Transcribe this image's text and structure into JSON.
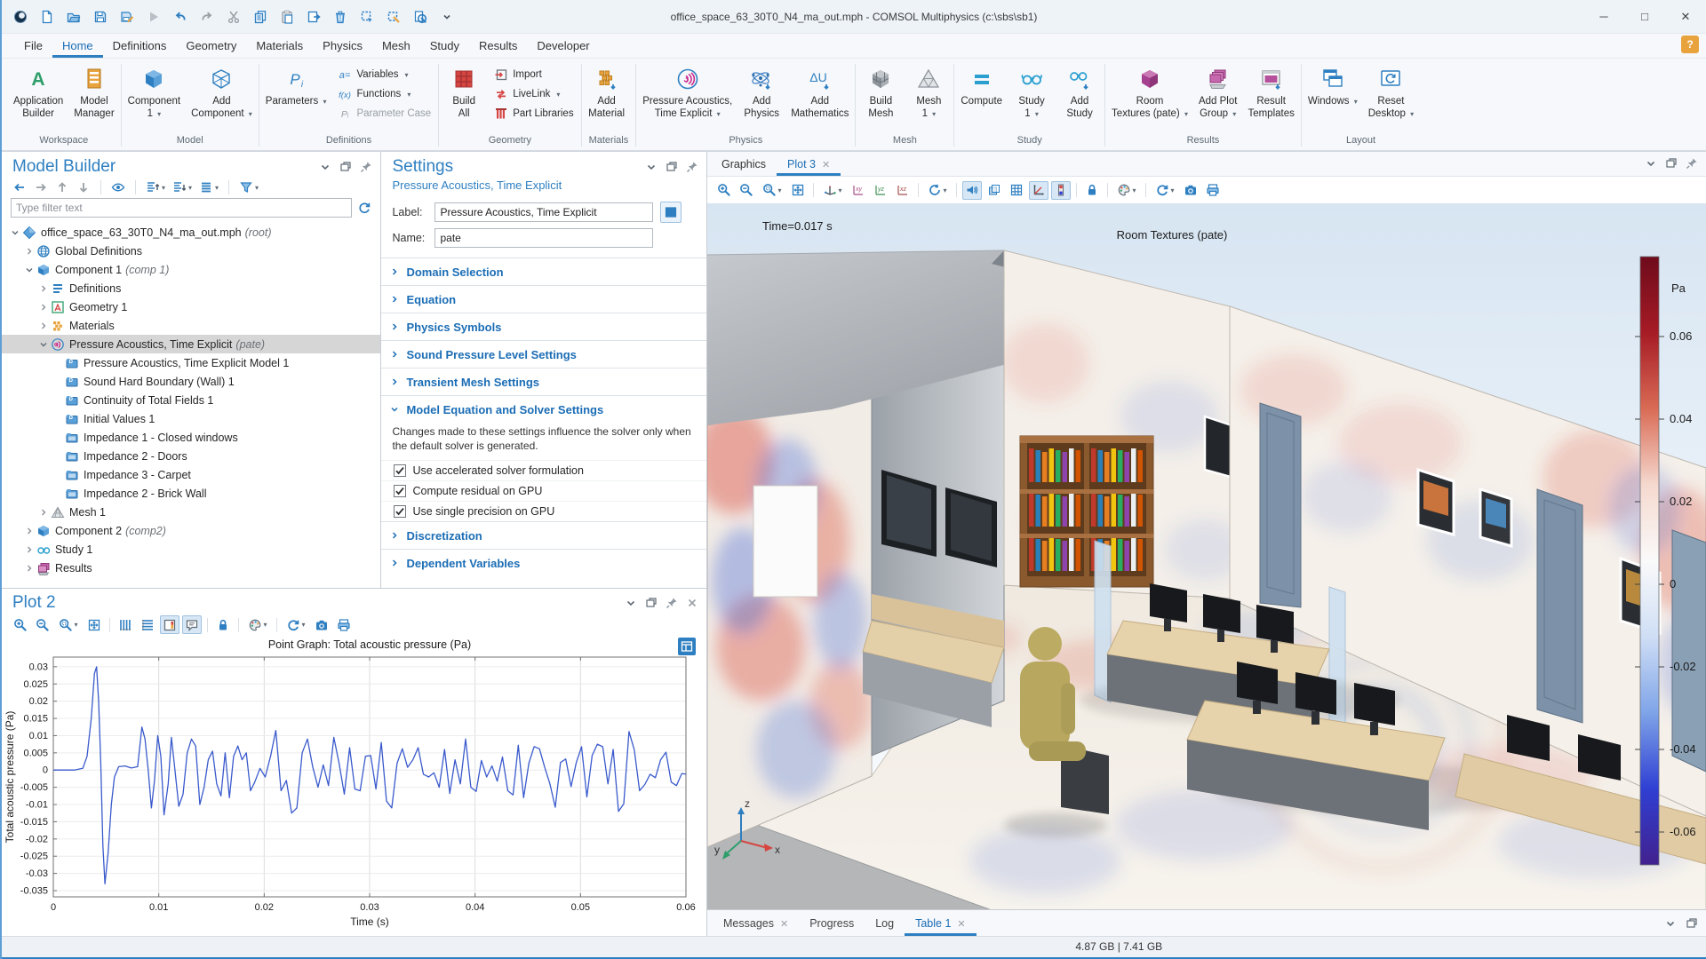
{
  "colors": {
    "accent": "#2e7fc1",
    "link": "#1b6db5",
    "selection": "#d6d6d6",
    "line": "#3a5acc",
    "ribbon_red": "#d64541",
    "ribbon_orange": "#e8a33d",
    "ribbon_green": "#2e9e6b",
    "ribbon_teal": "#2a9fd0",
    "ribbon_magenta": "#b5509c"
  },
  "window": {
    "title": "office_space_63_30T0_N4_ma_out.mph - COMSOL Multiphysics (c:\\sbs\\sb1)",
    "controls": [
      "minimize",
      "maximize",
      "close"
    ]
  },
  "quickbar": [
    "comsol-logo",
    "new-file",
    "open-file",
    "save",
    "save-as",
    "run",
    "undo",
    "redo",
    "cut",
    "copy",
    "paste",
    "duplicate",
    "delete",
    "select-box",
    "clear-selection",
    "zoom-selected",
    "collapse-ribbon"
  ],
  "menu": {
    "items": [
      "File",
      "Home",
      "Definitions",
      "Geometry",
      "Materials",
      "Physics",
      "Mesh",
      "Study",
      "Results",
      "Developer"
    ],
    "active": "Home",
    "help": "?"
  },
  "ribbon": {
    "groups": [
      {
        "label": "Workspace",
        "big": [
          {
            "label": "Application\nBuilder",
            "icon": "appbuilder"
          },
          {
            "label": "Model\nManager",
            "icon": "modelmanager"
          }
        ]
      },
      {
        "label": "Model",
        "big": [
          {
            "label": "Component\n1",
            "icon": "component",
            "arrow": true
          },
          {
            "label": "Add\nComponent",
            "icon": "addcomponent",
            "arrow": true
          }
        ]
      },
      {
        "label": "Definitions",
        "big": [
          {
            "label": "Parameters",
            "icon": "parameters",
            "arrow": true
          }
        ],
        "small": [
          {
            "label": "Variables",
            "icon": "aeq",
            "arrow": true
          },
          {
            "label": "Functions",
            "icon": "fx",
            "arrow": true
          },
          {
            "label": "Parameter Case",
            "icon": "pigray",
            "disabled": true
          }
        ]
      },
      {
        "label": "Geometry",
        "big": [
          {
            "label": "Build\nAll",
            "icon": "buildall"
          }
        ],
        "small": [
          {
            "label": "Import",
            "icon": "import"
          },
          {
            "label": "LiveLink",
            "icon": "livelink",
            "arrow": true
          },
          {
            "label": "Part Libraries",
            "icon": "partlib"
          }
        ]
      },
      {
        "label": "Materials",
        "big": [
          {
            "label": "Add\nMaterial",
            "icon": "addmaterial"
          }
        ]
      },
      {
        "label": "Physics",
        "big": [
          {
            "label": "Pressure Acoustics,\nTime Explicit",
            "icon": "acoustics",
            "arrow": true,
            "wide": true
          },
          {
            "label": "Add\nPhysics",
            "icon": "addphysics"
          },
          {
            "label": "Add\nMathematics",
            "icon": "addmath"
          }
        ]
      },
      {
        "label": "Mesh",
        "big": [
          {
            "label": "Build\nMesh",
            "icon": "buildmesh"
          },
          {
            "label": "Mesh\n1",
            "icon": "mesh1",
            "arrow": true
          }
        ]
      },
      {
        "label": "Study",
        "big": [
          {
            "label": "Compute",
            "icon": "compute"
          },
          {
            "label": "Study\n1",
            "icon": "study",
            "arrow": true
          },
          {
            "label": "Add\nStudy",
            "icon": "addstudy"
          }
        ]
      },
      {
        "label": "Results",
        "big": [
          {
            "label": "Room\nTextures (pate)",
            "icon": "roomtextures",
            "arrow": true
          },
          {
            "label": "Add Plot\nGroup",
            "icon": "addplotgroup",
            "arrow": true
          },
          {
            "label": "Result\nTemplates",
            "icon": "resulttemplates"
          }
        ]
      },
      {
        "label": "Layout",
        "big": [
          {
            "label": "Windows",
            "icon": "windows",
            "arrow": true
          },
          {
            "label": "Reset\nDesktop",
            "icon": "resetdesktop",
            "arrow": true
          }
        ]
      }
    ]
  },
  "model_builder": {
    "title": "Model Builder",
    "toolbar": [
      "arrow-left",
      "arrow-right",
      "arrow-up",
      "arrow-down",
      "sep",
      "eye",
      "sep",
      "collapse-up",
      "expand-down",
      "listview",
      "sep",
      "filter"
    ],
    "filter_placeholder": "Type filter text",
    "tree": [
      {
        "depth": 0,
        "chev": "v",
        "icon": "mph",
        "label": "office_space_63_30T0_N4_ma_out.mph",
        "suffix": "(root)"
      },
      {
        "depth": 1,
        "chev": ">",
        "icon": "globe",
        "label": "Global Definitions"
      },
      {
        "depth": 1,
        "chev": "v",
        "icon": "component",
        "label": "Component 1",
        "suffix": "(comp 1)"
      },
      {
        "depth": 2,
        "chev": ">",
        "icon": "definitions",
        "label": "Definitions"
      },
      {
        "depth": 2,
        "chev": ">",
        "icon": "geometry",
        "label": "Geometry 1"
      },
      {
        "depth": 2,
        "chev": ">",
        "icon": "materials",
        "label": "Materials"
      },
      {
        "depth": 2,
        "chev": "v",
        "icon": "acoustics",
        "label": "Pressure Acoustics, Time Explicit",
        "suffix": "(pate)",
        "selected": true
      },
      {
        "depth": 3,
        "chev": "",
        "icon": "nodeD",
        "label": "Pressure Acoustics, Time Explicit Model 1"
      },
      {
        "depth": 3,
        "chev": "",
        "icon": "nodeD",
        "label": "Sound Hard Boundary (Wall) 1"
      },
      {
        "depth": 3,
        "chev": "",
        "icon": "nodeD",
        "label": "Continuity of Total Fields 1"
      },
      {
        "depth": 3,
        "chev": "",
        "icon": "nodeD",
        "label": "Initial Values 1"
      },
      {
        "depth": 3,
        "chev": "",
        "icon": "node",
        "label": "Impedance 1 - Closed windows"
      },
      {
        "depth": 3,
        "chev": "",
        "icon": "node",
        "label": "Impedance 2 - Doors"
      },
      {
        "depth": 3,
        "chev": "",
        "icon": "node",
        "label": "Impedance 3 - Carpet"
      },
      {
        "depth": 3,
        "chev": "",
        "icon": "node",
        "label": "Impedance 2 - Brick Wall"
      },
      {
        "depth": 2,
        "chev": ">",
        "icon": "mesh",
        "label": "Mesh 1"
      },
      {
        "depth": 1,
        "chev": ">",
        "icon": "component",
        "label": "Component 2",
        "suffix": "(comp2)"
      },
      {
        "depth": 1,
        "chev": ">",
        "icon": "study",
        "label": "Study 1"
      },
      {
        "depth": 1,
        "chev": ">",
        "icon": "results",
        "label": "Results"
      }
    ]
  },
  "settings": {
    "title": "Settings",
    "subtitle": "Pressure Acoustics, Time Explicit",
    "label_caption": "Label:",
    "label_value": "Pressure Acoustics, Time Explicit",
    "name_caption": "Name:",
    "name_value": "pate",
    "sections_top": [
      "Domain Selection",
      "Equation",
      "Physics Symbols",
      "Sound Pressure Level Settings",
      "Transient Mesh Settings"
    ],
    "expanded_section": {
      "title": "Model Equation and Solver Settings",
      "note": "Changes made to these settings influence the solver only when the default solver is generated.",
      "checkboxes": [
        {
          "label": "Use accelerated solver formulation",
          "checked": true
        },
        {
          "label": "Compute residual on GPU",
          "checked": true
        },
        {
          "label": "Use single precision on GPU",
          "checked": true
        }
      ]
    },
    "sections_bottom": [
      "Discretization",
      "Dependent Variables"
    ]
  },
  "plot2": {
    "title": "Plot 2",
    "toolbar": [
      "zoom-in",
      "zoom-out",
      "zoom-box+",
      "fit",
      "sep",
      "xgrid",
      "ygrid",
      "legend*",
      "note*",
      "sep",
      "lock",
      "sep",
      "palette+",
      "sep",
      "refresh+",
      "camera",
      "print"
    ],
    "chart_data": {
      "type": "line",
      "title": "Point Graph: Total acoustic pressure (Pa)",
      "xlabel": "Time (s)",
      "ylabel": "Total acoustic pressure (Pa)",
      "xlim": [
        0,
        0.06
      ],
      "ylim": [
        -0.0368,
        0.0328
      ],
      "xticks": [
        "0",
        "0.01",
        "0.02",
        "0.03",
        "0.04",
        "0.05",
        "0.06"
      ],
      "yticks": [
        "0.03",
        "0.025",
        "0.02",
        "0.015",
        "0.01",
        "0.005",
        "0",
        "-0.005",
        "-0.01",
        "-0.015",
        "-0.02",
        "-0.025",
        "-0.03",
        "-0.035"
      ],
      "grid": true,
      "line_color": "#3a5acc",
      "points": [
        [
          0,
          0
        ],
        [
          0.002,
          0
        ],
        [
          0.0028,
          0.0005
        ],
        [
          0.0032,
          0.004
        ],
        [
          0.0036,
          0.015
        ],
        [
          0.0039,
          0.028
        ],
        [
          0.0041,
          0.03
        ],
        [
          0.0043,
          0.02
        ],
        [
          0.0045,
          0.002
        ],
        [
          0.0047,
          -0.022
        ],
        [
          0.0049,
          -0.033
        ],
        [
          0.0052,
          -0.024
        ],
        [
          0.0055,
          -0.01
        ],
        [
          0.0058,
          -0.002
        ],
        [
          0.0062,
          0.001
        ],
        [
          0.0068,
          0.0012
        ],
        [
          0.0074,
          0.0006
        ],
        [
          0.008,
          0.001
        ],
        [
          0.0084,
          0.0125
        ],
        [
          0.0087,
          0.009
        ],
        [
          0.009,
          0
        ],
        [
          0.0093,
          -0.011
        ],
        [
          0.0096,
          -0.003
        ],
        [
          0.0099,
          0.01
        ],
        [
          0.0102,
          0.004
        ],
        [
          0.0105,
          -0.013
        ],
        [
          0.0109,
          -0.004
        ],
        [
          0.0112,
          0.0095
        ],
        [
          0.0115,
          0.001
        ],
        [
          0.0119,
          -0.0105
        ],
        [
          0.0123,
          -0.007
        ],
        [
          0.0127,
          0.005
        ],
        [
          0.0131,
          0.009
        ],
        [
          0.0135,
          0.007
        ],
        [
          0.0139,
          -0.01
        ],
        [
          0.0143,
          -0.005
        ],
        [
          0.0147,
          0.003
        ],
        [
          0.0151,
          0.0055
        ],
        [
          0.0155,
          -0.004
        ],
        [
          0.0159,
          -0.0075
        ],
        [
          0.0163,
          0.005
        ],
        [
          0.0167,
          -0.008
        ],
        [
          0.0171,
          0.004
        ],
        [
          0.0175,
          0.007
        ],
        [
          0.0179,
          0.003
        ],
        [
          0.0183,
          0.005
        ],
        [
          0.0187,
          -0.006
        ],
        [
          0.0191,
          -0.0035
        ],
        [
          0.0196,
          0.0005
        ],
        [
          0.0201,
          -0.002
        ],
        [
          0.0206,
          0.004
        ],
        [
          0.0211,
          0.0115
        ],
        [
          0.0216,
          -0.006
        ],
        [
          0.0221,
          -0.003
        ],
        [
          0.0226,
          -0.0125
        ],
        [
          0.0231,
          -0.011
        ],
        [
          0.0236,
          0.005
        ],
        [
          0.0241,
          0.009
        ],
        [
          0.0246,
          0.001
        ],
        [
          0.0251,
          -0.005
        ],
        [
          0.0256,
          0.0015
        ],
        [
          0.0261,
          -0.0045
        ],
        [
          0.0266,
          0.0095
        ],
        [
          0.0271,
          0.002
        ],
        [
          0.0276,
          -0.007
        ],
        [
          0.0281,
          0.0065
        ],
        [
          0.0286,
          -0.0055
        ],
        [
          0.0291,
          -0.006
        ],
        [
          0.0296,
          0.004
        ],
        [
          0.0301,
          0.0042
        ],
        [
          0.0306,
          -0.0055
        ],
        [
          0.0311,
          0.008
        ],
        [
          0.0316,
          -0.009
        ],
        [
          0.0321,
          -0.011
        ],
        [
          0.0326,
          0.002
        ],
        [
          0.0331,
          0.0062
        ],
        [
          0.0336,
          0.0008
        ],
        [
          0.0341,
          0.003
        ],
        [
          0.0346,
          0.0065
        ],
        [
          0.0351,
          -0.0012
        ],
        [
          0.0356,
          -0.002
        ],
        [
          0.0361,
          -0.0008
        ],
        [
          0.0366,
          -0.005
        ],
        [
          0.0371,
          0.006
        ],
        [
          0.0376,
          -0.0068
        ],
        [
          0.0381,
          0.003
        ],
        [
          0.0386,
          -0.004
        ],
        [
          0.0391,
          0.009
        ],
        [
          0.0396,
          -0.005
        ],
        [
          0.0401,
          -0.0062
        ],
        [
          0.0406,
          0.0028
        ],
        [
          0.0411,
          -0.002
        ],
        [
          0.0416,
          0.0012
        ],
        [
          0.0421,
          -0.0032
        ],
        [
          0.0426,
          0.0038
        ],
        [
          0.0431,
          -0.006
        ],
        [
          0.0436,
          -0.0072
        ],
        [
          0.0441,
          0.0072
        ],
        [
          0.0446,
          -0.008
        ],
        [
          0.0451,
          0.002
        ],
        [
          0.0456,
          0.0068
        ],
        [
          0.0461,
          0.0062
        ],
        [
          0.0466,
          0.0008
        ],
        [
          0.0471,
          -0.004
        ],
        [
          0.0476,
          -0.0108
        ],
        [
          0.0481,
          0.0022
        ],
        [
          0.0486,
          0.0032
        ],
        [
          0.0491,
          -0.0048
        ],
        [
          0.0496,
          0.0022
        ],
        [
          0.0501,
          0.0068
        ],
        [
          0.0506,
          -0.0078
        ],
        [
          0.0511,
          0.0042
        ],
        [
          0.0516,
          0.0075
        ],
        [
          0.0521,
          0.0068
        ],
        [
          0.0526,
          -0.004
        ],
        [
          0.0531,
          0.006
        ],
        [
          0.0536,
          -0.012
        ],
        [
          0.0541,
          -0.0098
        ],
        [
          0.0546,
          0.0112
        ],
        [
          0.0551,
          0.0058
        ],
        [
          0.0556,
          -0.006
        ],
        [
          0.0561,
          -0.0042
        ],
        [
          0.0566,
          -0.0012
        ],
        [
          0.0571,
          -0.0022
        ],
        [
          0.0576,
          0.003
        ],
        [
          0.0581,
          0.0052
        ],
        [
          0.0586,
          -0.0035
        ],
        [
          0.0591,
          -0.0045
        ],
        [
          0.0596,
          -0.001
        ],
        [
          0.06,
          -0.0012
        ]
      ]
    }
  },
  "graphics": {
    "tabs": [
      {
        "label": "Graphics",
        "active": false,
        "closable": false
      },
      {
        "label": "Plot 3",
        "active": true,
        "closable": true
      }
    ],
    "toolbar": [
      "zoom-in",
      "zoom-out",
      "zoom-box+",
      "fit",
      "sep",
      "triad+",
      "viewxy",
      "viewyz",
      "viewxz",
      "sep",
      "rotate+",
      "sep",
      "sound*",
      "transp",
      "grid",
      "axvis*",
      "cbar*",
      "sep",
      "lock",
      "sep",
      "palette+",
      "sep",
      "refresh+",
      "camera",
      "print"
    ],
    "time_label": "Time=0.017 s",
    "plot_label": "Room Textures (pate)",
    "colorbar": {
      "unit": "Pa",
      "ticks": [
        "0.06",
        "0.04",
        "0.02",
        "0",
        "-0.02",
        "-0.04",
        "-0.06"
      ],
      "colors": [
        "#6e0b1c",
        "#a61b25",
        "#d96b55",
        "#f5d9cf",
        "#fafafa",
        "#cfdef5",
        "#7fa4e8",
        "#2f3fd3",
        "#42218e"
      ]
    },
    "triad": {
      "x": "x",
      "y": "y",
      "z": "z"
    }
  },
  "bottom_tabs": [
    {
      "label": "Messages",
      "active": false,
      "closable": true
    },
    {
      "label": "Progress",
      "active": false,
      "closable": false
    },
    {
      "label": "Log",
      "active": false,
      "closable": false
    },
    {
      "label": "Table 1",
      "active": true,
      "closable": true
    }
  ],
  "status_bar": {
    "memory": "4.87 GB | 7.41 GB"
  }
}
